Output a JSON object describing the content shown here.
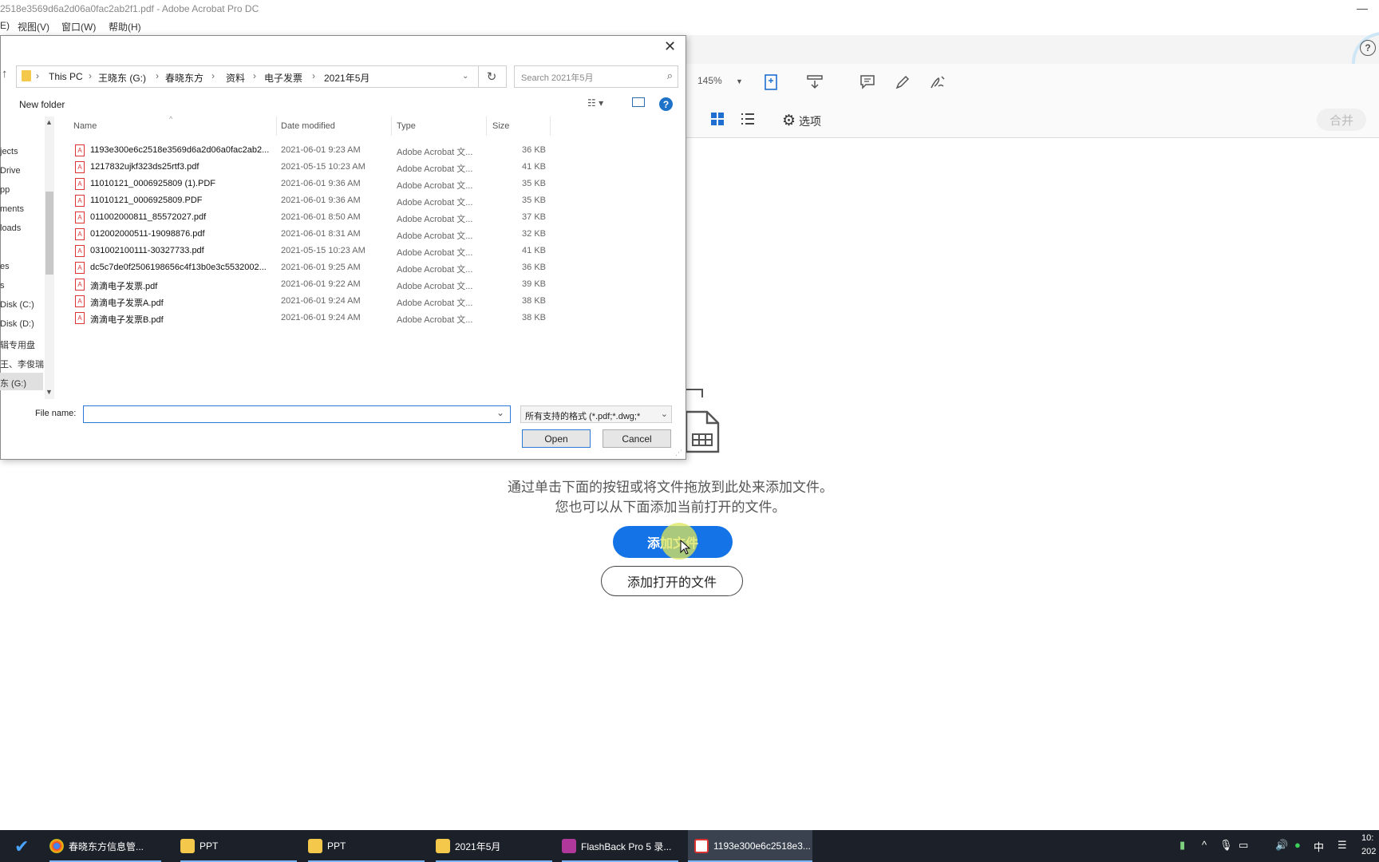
{
  "window": {
    "title": "2518e3569d6a2d06a0fac2ab2f1.pdf - Adobe Acrobat Pro DC",
    "controls": "—"
  },
  "menubar": {
    "items": [
      "E)",
      "视图(V)",
      "窗口(W)",
      "帮助(H)"
    ]
  },
  "toolbar": {
    "zoom": "145%",
    "options_label": "选项",
    "merge_label": "合并",
    "help_symbol": "?"
  },
  "dropzone": {
    "line1": "通过单击下面的按钮或将文件拖放到此处来添加文件。",
    "line2": "您也可以从下面添加当前打开的文件。",
    "add_files_label": "添加文件",
    "add_open_label": "添加打开的文件"
  },
  "dialog": {
    "close_symbol": "✕",
    "breadcrumb": [
      "This PC",
      "王晓东 (G:)",
      "春晓东方",
      "资料",
      "电子发票",
      "2021年5月"
    ],
    "search_placeholder": "Search 2021年5月",
    "new_folder_label": "New folder",
    "help_symbol": "?",
    "nav_items": [
      "jects",
      "Drive",
      "pp",
      "ments",
      "loads",
      "",
      "es",
      "s",
      "Disk (C:)",
      "Disk (D:)",
      "辑专用盘",
      "王、李俊瑞",
      "东 (G:)"
    ],
    "columns": {
      "name": "Name",
      "date": "Date modified",
      "type": "Type",
      "size": "Size"
    },
    "files": [
      {
        "name": "1193e300e6c2518e3569d6a2d06a0fac2ab2...",
        "date": "2021-06-01 9:23 AM",
        "type": "Adobe Acrobat 文...",
        "size": "36 KB"
      },
      {
        "name": "1217832ujkf323ds25rtf3.pdf",
        "date": "2021-05-15 10:23 AM",
        "type": "Adobe Acrobat 文...",
        "size": "41 KB"
      },
      {
        "name": "11010121_0006925809 (1).PDF",
        "date": "2021-06-01 9:36 AM",
        "type": "Adobe Acrobat 文...",
        "size": "35 KB"
      },
      {
        "name": "11010121_0006925809.PDF",
        "date": "2021-06-01 9:36 AM",
        "type": "Adobe Acrobat 文...",
        "size": "35 KB"
      },
      {
        "name": "011002000811_85572027.pdf",
        "date": "2021-06-01 8:50 AM",
        "type": "Adobe Acrobat 文...",
        "size": "37 KB"
      },
      {
        "name": "012002000511-19098876.pdf",
        "date": "2021-06-01 8:31 AM",
        "type": "Adobe Acrobat 文...",
        "size": "32 KB"
      },
      {
        "name": "031002100111-30327733.pdf",
        "date": "2021-05-15 10:23 AM",
        "type": "Adobe Acrobat 文...",
        "size": "41 KB"
      },
      {
        "name": "dc5c7de0f2506198656c4f13b0e3c5532002...",
        "date": "2021-06-01 9:25 AM",
        "type": "Adobe Acrobat 文...",
        "size": "36 KB"
      },
      {
        "name": "滴滴电子发票.pdf",
        "date": "2021-06-01 9:22 AM",
        "type": "Adobe Acrobat 文...",
        "size": "39 KB"
      },
      {
        "name": "滴滴电子发票A.pdf",
        "date": "2021-06-01 9:24 AM",
        "type": "Adobe Acrobat 文...",
        "size": "38 KB"
      },
      {
        "name": "滴滴电子发票B.pdf",
        "date": "2021-06-01 9:24 AM",
        "type": "Adobe Acrobat 文...",
        "size": "38 KB"
      }
    ],
    "file_name_label": "File name:",
    "file_name_value": "",
    "file_type_value": "所有支持的格式 (*.pdf;*.dwg;*",
    "open_label": "Open",
    "cancel_label": "Cancel"
  },
  "taskbar": {
    "items": [
      {
        "label": "春晓东方信息管...",
        "icon": "chrome-icon"
      },
      {
        "label": "PPT",
        "icon": "folder-icon"
      },
      {
        "label": "PPT",
        "icon": "folder-icon"
      },
      {
        "label": "2021年5月",
        "icon": "folder-icon"
      },
      {
        "label": "FlashBack Pro 5 录...",
        "icon": "recorder-icon"
      },
      {
        "label": "1193e300e6c2518e3...",
        "icon": "acrobat-icon"
      }
    ],
    "ime_label": "中",
    "clock_time": "10:",
    "clock_date": "202"
  },
  "colors": {
    "accent": "#1473e6",
    "taskbar": "#1c2129",
    "pdf_red": "#d33333"
  }
}
